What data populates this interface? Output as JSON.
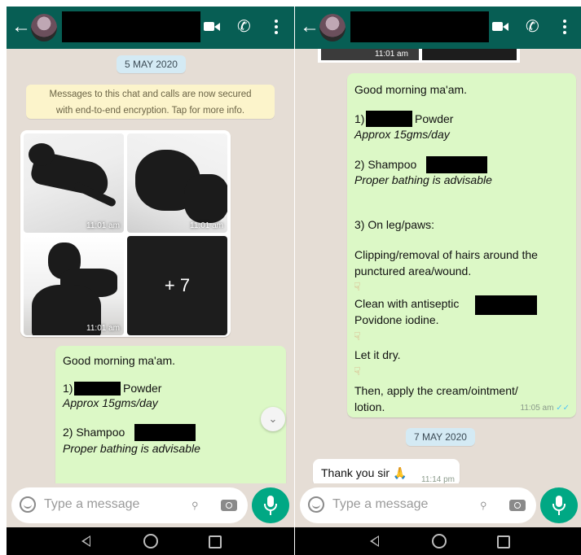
{
  "header": {
    "back_icon": "arrow-left-icon",
    "video_icon": "video-call-icon",
    "call_icon": "phone-icon",
    "menu_icon": "more-vert-icon"
  },
  "left": {
    "date_chip": "5 MAY 2020",
    "encryption_notice": [
      "Messages to this chat and calls are now secured",
      "with end-to-end encryption. Tap for more info."
    ],
    "photo_times": [
      "11:01 am",
      "11:01 am",
      "11:01 am"
    ],
    "more_photos": "+ 7",
    "message": {
      "greeting": "Good morning ma'am.",
      "item1_prefix": "1)",
      "item1_text": "Powder",
      "item1_note": "Approx 15gms/day",
      "item2_text": "2) Shampoo",
      "item2_note": "Proper bathing is advisable"
    }
  },
  "right": {
    "top_partial_time": "11:01 am",
    "message": {
      "greeting": "Good morning ma'am.",
      "item1_prefix": "1)",
      "item1_text": "Powder",
      "item1_note": "Approx 15gms/day",
      "item2_text": "2) Shampoo",
      "item2_note": "Proper bathing is advisable",
      "item3": "3) On leg/paws:",
      "step1a": "Clipping/removal of hairs around the",
      "step1b": "punctured area/wound.",
      "step2a": "Clean with antiseptic",
      "step2b": "Povidone iodine.",
      "step3": "Let it dry.",
      "step4a": "Then, apply the cream/ointment/",
      "step4b": "lotion.",
      "time": "11:05 am",
      "ticks": "✓✓"
    },
    "date_chip": "7 MAY 2020",
    "incoming": {
      "text": "Thank you sir",
      "emoji": "🙏",
      "time": "11:14 pm"
    }
  },
  "input": {
    "placeholder": "Type a message",
    "emoji_icon": "emoji-icon",
    "attach_icon": "paperclip-icon",
    "camera_icon": "camera-icon",
    "mic_icon": "mic-icon"
  },
  "nav": {
    "back": "nav-back-icon",
    "home": "nav-home-icon",
    "recents": "nav-recents-icon"
  },
  "colors": {
    "header": "#075e54",
    "chat_bg": "#e5ddd5",
    "outgoing": "#dcf8c6",
    "date_chip": "#d4eaf4",
    "notice": "#fcf4cb",
    "mic": "#00a884"
  }
}
